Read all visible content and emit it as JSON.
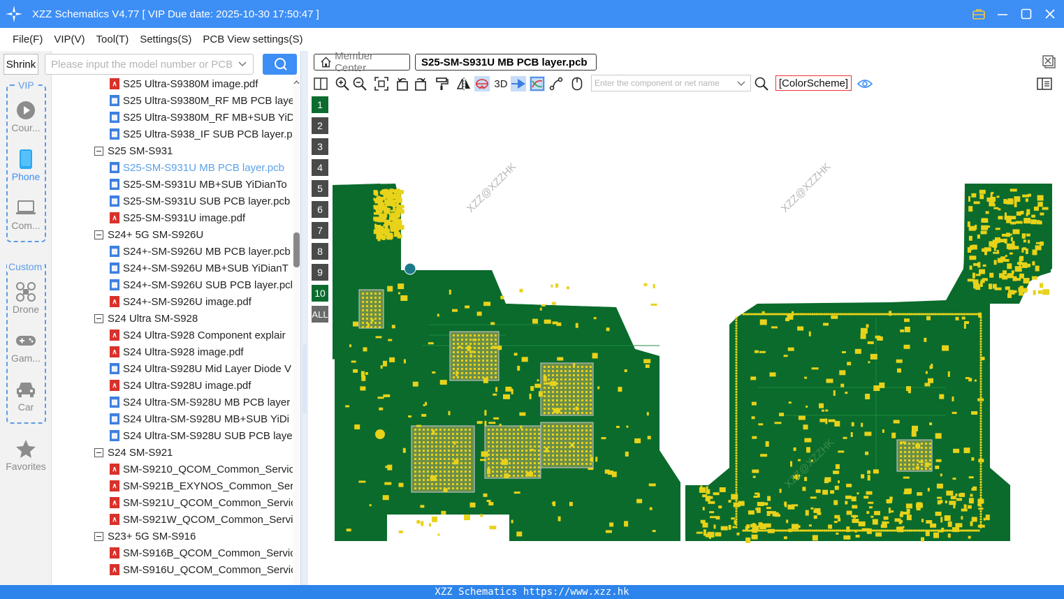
{
  "window": {
    "title": "XZZ Schematics V4.77 [ VIP Due date: 2025-10-30 17:50:47 ]",
    "accent": "#3d8ef5"
  },
  "menu": [
    "File(F)",
    "VIP(V)",
    "Tool(T)",
    "Settings(S)",
    "PCB View settings(S)"
  ],
  "rail": {
    "shrink_label": "Shrink",
    "vip_label": "VIP",
    "custom_label": "Custom",
    "items": [
      {
        "label": "Cour...",
        "icon": "play-circle-icon"
      },
      {
        "label": "Phone",
        "icon": "phone-icon"
      },
      {
        "label": "Com...",
        "icon": "laptop-icon"
      },
      {
        "label": "Drone",
        "icon": "drone-icon"
      },
      {
        "label": "Gam...",
        "icon": "gamepad-icon"
      },
      {
        "label": "Car",
        "icon": "car-icon"
      },
      {
        "label": "Favorites",
        "icon": "star-icon"
      }
    ]
  },
  "search": {
    "placeholder": "Please input the model number or PCB"
  },
  "tree": [
    {
      "type": "pdf",
      "label": "S25 Ultra-S9380M image.pdf"
    },
    {
      "type": "pcb",
      "label": "S25 Ultra-S9380M_RF MB PCB laye"
    },
    {
      "type": "pcb",
      "label": "S25 Ultra-S9380M_RF MB+SUB YiD"
    },
    {
      "type": "pcb",
      "label": "S25 Ultra-S938_IF SUB PCB layer.pc"
    },
    {
      "type": "folder",
      "label": "S25 SM-S931"
    },
    {
      "type": "pcb",
      "label": "S25-SM-S931U MB PCB layer.pcb",
      "selected": true
    },
    {
      "type": "pcb",
      "label": "S25-SM-S931U MB+SUB YiDianTo"
    },
    {
      "type": "pcb",
      "label": "S25-SM-S931U SUB PCB layer.pcb"
    },
    {
      "type": "pdf",
      "label": "S25-SM-S931U image.pdf"
    },
    {
      "type": "folder",
      "label": "S24+ 5G SM-S926U"
    },
    {
      "type": "pcb",
      "label": "S24+-SM-S926U MB PCB layer.pcb"
    },
    {
      "type": "pcb",
      "label": "S24+-SM-S926U MB+SUB YiDianT"
    },
    {
      "type": "pcb",
      "label": "S24+-SM-S926U SUB PCB layer.pcl"
    },
    {
      "type": "pdf",
      "label": "S24+-SM-S926U image.pdf"
    },
    {
      "type": "folder",
      "label": "S24 Ultra SM-S928"
    },
    {
      "type": "pdf",
      "label": "S24 Ultra-S928 Component explair"
    },
    {
      "type": "pdf",
      "label": "S24 Ultra-S928 image.pdf"
    },
    {
      "type": "pcb",
      "label": "S24 Ultra-S928U Mid Layer Diode V"
    },
    {
      "type": "pdf",
      "label": "S24 Ultra-S928U image.pdf"
    },
    {
      "type": "pcb",
      "label": "S24 Ultra-SM-S928U MB PCB layer"
    },
    {
      "type": "pcb",
      "label": "S24 Ultra-SM-S928U MB+SUB YiDi"
    },
    {
      "type": "pcb",
      "label": "S24 Ultra-SM-S928U SUB PCB layer"
    },
    {
      "type": "folder",
      "label": "S24 SM-S921"
    },
    {
      "type": "pdf",
      "label": "SM-S9210_QCOM_Common_Servic"
    },
    {
      "type": "pdf",
      "label": "SM-S921B_EXYNOS_Common_Serv"
    },
    {
      "type": "pdf",
      "label": "SM-S921U_QCOM_Common_Servic"
    },
    {
      "type": "pdf",
      "label": "SM-S921W_QCOM_Common_Servi"
    },
    {
      "type": "folder",
      "label": "S23+ 5G SM-S916"
    },
    {
      "type": "pdf",
      "label": "SM-S916B_QCOM_Common_Servic"
    },
    {
      "type": "pdf",
      "label": "SM-S916U_QCOM_Common_Servic"
    }
  ],
  "tabs": {
    "member": "Member Center",
    "active": "S25-SM-S931U MB PCB layer.pcb"
  },
  "toolbar": {
    "three_d": "3D",
    "component_placeholder": "Enter the component or net name",
    "color_scheme": "[ColorScheme]"
  },
  "layers": [
    "1",
    "2",
    "3",
    "4",
    "5",
    "6",
    "7",
    "8",
    "9",
    "10",
    "ALL"
  ],
  "board": {
    "watermark": "XZZ@XZZHK",
    "pcb_color": "#0a6b2c",
    "pad_color": "#e8d21a"
  },
  "status": "XZZ Schematics https://www.xzz.hk"
}
